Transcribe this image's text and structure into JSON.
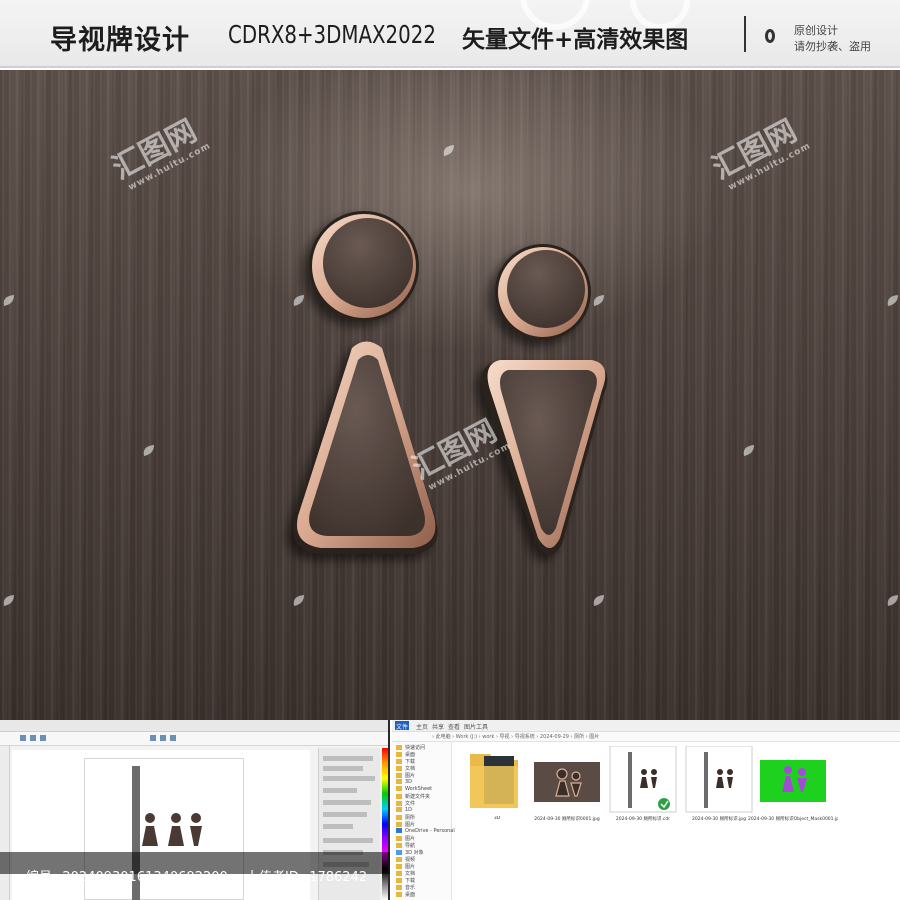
{
  "header": {
    "title": "导视牌设计",
    "software": "CDRX8+3DMAX2022",
    "files": "矢量文件+高清效果图",
    "note_line1": "原创设计",
    "note_line2": "请勿抄袭、盗用"
  },
  "watermark": {
    "brand": "汇图网",
    "url": "www.huitu.com"
  },
  "explorer": {
    "tabs": [
      "文件",
      "主页",
      "共享",
      "查看",
      "图片工具"
    ],
    "path": "› 此电脑 › Work (J:) › work › 导视 › 导视系统 › 2024-09-29 › 厕所 › 图片",
    "nav_items": [
      "快速访问",
      "桌面",
      "下载",
      "文档",
      "图片",
      "3D",
      "WorkSheet",
      "新建文件夹",
      "文件",
      "1D",
      "厕所",
      "图片",
      "OneDrive - Personal",
      "图片",
      "导航",
      "3D 对象",
      "视频",
      "图片",
      "文档",
      "下载",
      "音乐",
      "桌面"
    ],
    "thumbnails": [
      {
        "caption": "3D"
      },
      {
        "caption": "2024-09-30 厕所标识0001.jpg"
      },
      {
        "caption": "2024-09-30 厕所标识.cdr"
      },
      {
        "caption": "2024-09-30 厕所标识.jpg"
      },
      {
        "caption": "2024-09-30 厕所标识Object_Mask0001.jpg"
      }
    ]
  },
  "footer": {
    "id_label": "编号:",
    "id_value": "20240930161340692200",
    "uploader_label": "上传者ID:",
    "uploader_value": "1786242"
  },
  "colors": {
    "wood_dark": "#4b3f3a",
    "sign_rim": "#e8c5b1",
    "mask_green": "#1fd11f",
    "mask_purple": "#a24cd6"
  }
}
